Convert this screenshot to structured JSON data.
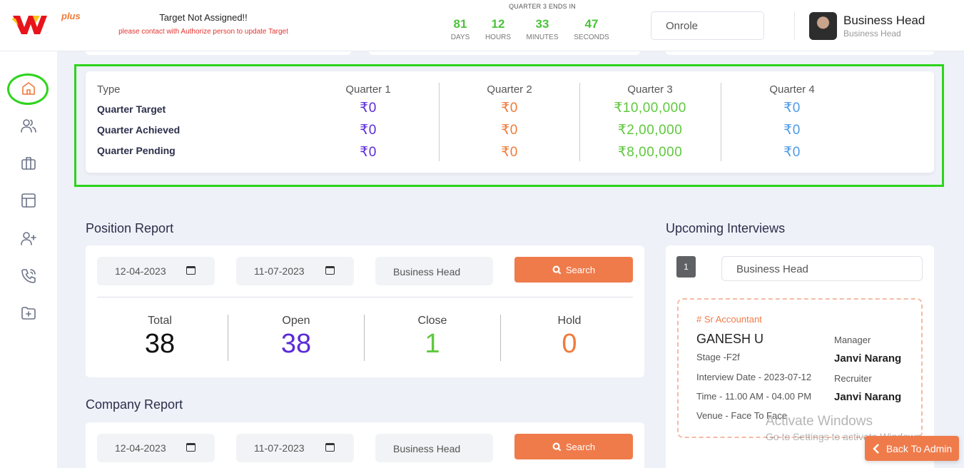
{
  "header": {
    "logo_plus": "plus",
    "target_title": "Target Not Assigned!!",
    "target_sub": "please contact with Authorize person to update Target",
    "quarter_ends": "QUARTER 3 ENDS IN",
    "countdown": [
      {
        "value": "81",
        "label": "DAYS"
      },
      {
        "value": "12",
        "label": "HOURS"
      },
      {
        "value": "33",
        "label": "MINUTES"
      },
      {
        "value": "47",
        "label": "SECONDS"
      }
    ],
    "role_select": "Onrole",
    "user_name": "Business Head",
    "user_role": "Business Head"
  },
  "sidebar": {
    "items": [
      "home-icon",
      "users-icon",
      "briefcase-icon",
      "layout-icon",
      "user-plus-icon",
      "phone-icon",
      "folder-plus-icon"
    ]
  },
  "quarters": {
    "type_label": "Type",
    "row_labels": [
      "Quarter Target",
      "Quarter Achieved",
      "Quarter Pending"
    ],
    "columns": [
      {
        "header": "Quarter 1",
        "color": "#5b2bd6",
        "values": [
          "₹0",
          "₹0",
          "₹0"
        ]
      },
      {
        "header": "Quarter 2",
        "color": "#f07a3a",
        "values": [
          "₹0",
          "₹0",
          "₹0"
        ]
      },
      {
        "header": "Quarter 3",
        "color": "#5fc83e",
        "values": [
          "₹10,00,000",
          "₹2,00,000",
          "₹8,00,000"
        ]
      },
      {
        "header": "Quarter 4",
        "color": "#4f9ae3",
        "values": [
          "₹0",
          "₹0",
          "₹0"
        ]
      }
    ]
  },
  "position_report": {
    "title": "Position Report",
    "from_date": "12-04-2023",
    "to_date": "11-07-2023",
    "role": "Business Head",
    "search_label": "Search",
    "stats": [
      {
        "label": "Total",
        "value": "38",
        "color": "#111111"
      },
      {
        "label": "Open",
        "value": "38",
        "color": "#5b2bd6"
      },
      {
        "label": "Close",
        "value": "1",
        "color": "#5fc83e"
      },
      {
        "label": "Hold",
        "value": "0",
        "color": "#f07a3a"
      }
    ]
  },
  "company_report": {
    "title": "Company Report",
    "from_date": "12-04-2023",
    "to_date": "11-07-2023",
    "role": "Business Head",
    "search_label": "Search"
  },
  "upcoming": {
    "title": "Upcoming Interviews",
    "count_badge": "1",
    "role_select": "Business Head",
    "interview": {
      "job": "# Sr Accountant",
      "candidate": "GANESH U",
      "stage": "Stage -F2f",
      "date": "Interview Date - 2023-07-12",
      "time": "Time - 11.00 AM - 04.00 PM",
      "venue": "Venue - Face To Face",
      "manager_label": "Manager",
      "manager": "Janvi Narang",
      "recruiter_label": "Recruiter",
      "recruiter": "Janvi Narang"
    }
  },
  "watermark": {
    "line1": "Activate Windows",
    "line2": "Go to Settings to activate Windows."
  },
  "back_button": "Back To Admin"
}
